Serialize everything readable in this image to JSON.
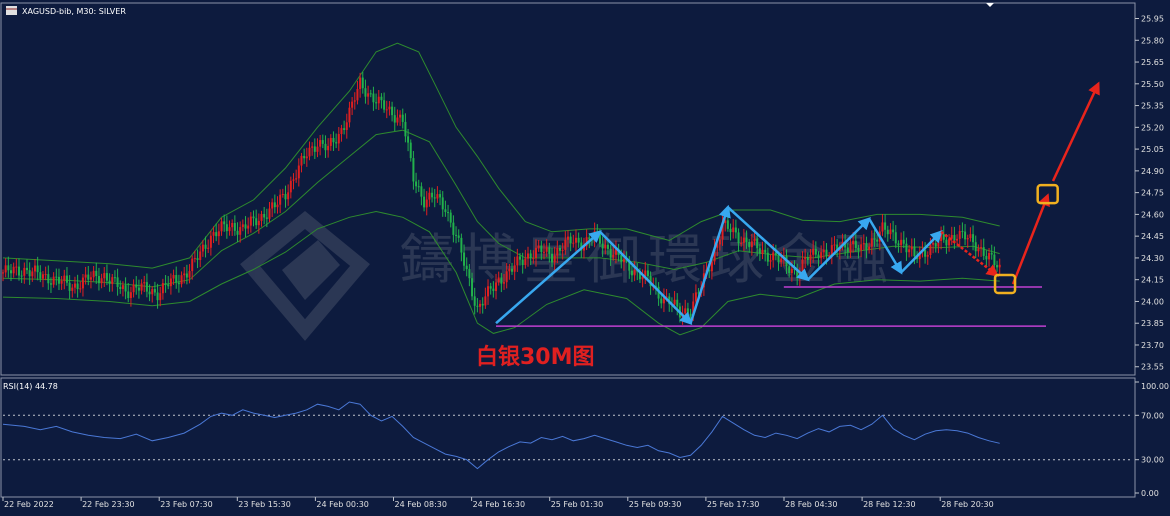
{
  "header": {
    "symbol_line": "XAGUSD-bib, M30:  SILVER",
    "rsi_line": "RSI(14) 44.78"
  },
  "annotation": {
    "title": "白银30M图"
  },
  "watermark": {
    "text": "鑄博皇御環球金融"
  },
  "colors": {
    "background": "#0d1b3e",
    "grid": "#1f2d55",
    "bull": "#e02020",
    "bear": "#22b14c",
    "bollinger": "#2e8b2e",
    "rsi_line": "#4a78d6",
    "support_line": "#c040d0",
    "blue_arrow": "#38a8f0",
    "red_arrow": "#e8241c",
    "target_box": "#f0b020",
    "title_red": "#e02020"
  },
  "chart_data": [
    {
      "type": "candlestick",
      "instrument": "XAGUSD-bib",
      "timeframe": "M30",
      "ylim": [
        23.5,
        26.05
      ],
      "yticks": [
        "25.95",
        "25.80",
        "25.65",
        "25.50",
        "25.35",
        "25.20",
        "25.05",
        "24.90",
        "24.75",
        "24.60",
        "24.45",
        "24.30",
        "24.15",
        "24.00",
        "23.85",
        "23.70",
        "23.55"
      ],
      "xticks": [
        "22 Feb 2022",
        "22 Feb 23:30",
        "23 Feb 07:30",
        "23 Feb 15:30",
        "24 Feb 00:30",
        "24 Feb 08:30",
        "24 Feb 16:30",
        "25 Feb 01:30",
        "25 Feb 09:30",
        "25 Feb 17:30",
        "28 Feb 04:30",
        "28 Feb 12:30",
        "28 Feb 20:30"
      ],
      "close_path": [
        [
          0,
          24.2
        ],
        [
          8,
          24.22
        ],
        [
          14,
          24.18
        ],
        [
          20,
          24.15
        ],
        [
          26,
          24.1
        ],
        [
          32,
          24.16
        ],
        [
          38,
          24.18
        ],
        [
          42,
          24.12
        ],
        [
          46,
          24.07
        ],
        [
          50,
          24.1
        ],
        [
          54,
          24.08
        ],
        [
          58,
          24.06
        ],
        [
          62,
          24.12
        ],
        [
          66,
          24.16
        ],
        [
          70,
          24.22
        ],
        [
          74,
          24.33
        ],
        [
          78,
          24.45
        ],
        [
          82,
          24.5
        ],
        [
          86,
          24.52
        ],
        [
          90,
          24.5
        ],
        [
          94,
          24.55
        ],
        [
          98,
          24.6
        ],
        [
          102,
          24.65
        ],
        [
          106,
          24.75
        ],
        [
          110,
          24.88
        ],
        [
          114,
          25.02
        ],
        [
          118,
          25.1
        ],
        [
          122,
          25.05
        ],
        [
          126,
          25.15
        ],
        [
          130,
          25.3
        ],
        [
          134,
          25.5
        ],
        [
          138,
          25.42
        ],
        [
          142,
          25.35
        ],
        [
          146,
          25.3
        ],
        [
          150,
          25.25
        ],
        [
          154,
          24.85
        ],
        [
          158,
          24.7
        ],
        [
          162,
          24.72
        ],
        [
          166,
          24.65
        ],
        [
          170,
          24.45
        ],
        [
          174,
          24.2
        ],
        [
          178,
          23.95
        ],
        [
          182,
          24.05
        ],
        [
          186,
          24.15
        ],
        [
          190,
          24.2
        ],
        [
          194,
          24.28
        ],
        [
          198,
          24.33
        ],
        [
          202,
          24.35
        ],
        [
          206,
          24.32
        ],
        [
          210,
          24.38
        ],
        [
          214,
          24.42
        ],
        [
          218,
          24.4
        ],
        [
          222,
          24.45
        ],
        [
          226,
          24.38
        ],
        [
          230,
          24.32
        ],
        [
          234,
          24.25
        ],
        [
          238,
          24.2
        ],
        [
          242,
          24.15
        ],
        [
          246,
          24.05
        ],
        [
          250,
          24.0
        ],
        [
          254,
          23.92
        ],
        [
          258,
          23.95
        ],
        [
          262,
          24.1
        ],
        [
          266,
          24.3
        ],
        [
          270,
          24.52
        ],
        [
          274,
          24.48
        ],
        [
          278,
          24.42
        ],
        [
          282,
          24.38
        ],
        [
          286,
          24.33
        ],
        [
          290,
          24.3
        ],
        [
          294,
          24.25
        ],
        [
          298,
          24.2
        ],
        [
          302,
          24.3
        ],
        [
          306,
          24.35
        ],
        [
          310,
          24.33
        ],
        [
          314,
          24.38
        ],
        [
          318,
          24.4
        ],
        [
          322,
          24.35
        ],
        [
          326,
          24.42
        ],
        [
          330,
          24.5
        ],
        [
          334,
          24.45
        ],
        [
          338,
          24.4
        ],
        [
          342,
          24.3
        ],
        [
          346,
          24.35
        ],
        [
          350,
          24.4
        ],
        [
          354,
          24.42
        ],
        [
          358,
          24.47
        ],
        [
          362,
          24.43
        ],
        [
          366,
          24.38
        ],
        [
          370,
          24.3
        ],
        [
          374,
          24.22
        ]
      ],
      "bollinger": {
        "upper": [
          [
            0,
            24.3
          ],
          [
            20,
            24.28
          ],
          [
            40,
            24.26
          ],
          [
            56,
            24.23
          ],
          [
            70,
            24.3
          ],
          [
            82,
            24.58
          ],
          [
            94,
            24.7
          ],
          [
            106,
            24.92
          ],
          [
            118,
            25.2
          ],
          [
            130,
            25.45
          ],
          [
            140,
            25.72
          ],
          [
            148,
            25.78
          ],
          [
            156,
            25.72
          ],
          [
            162,
            25.5
          ],
          [
            170,
            25.2
          ],
          [
            178,
            25.0
          ],
          [
            186,
            24.78
          ],
          [
            196,
            24.55
          ],
          [
            206,
            24.48
          ],
          [
            220,
            24.5
          ],
          [
            234,
            24.5
          ],
          [
            250,
            24.42
          ],
          [
            262,
            24.55
          ],
          [
            274,
            24.63
          ],
          [
            288,
            24.63
          ],
          [
            300,
            24.56
          ],
          [
            314,
            24.55
          ],
          [
            328,
            24.6
          ],
          [
            344,
            24.6
          ],
          [
            360,
            24.58
          ],
          [
            374,
            24.52
          ]
        ],
        "middle": [
          [
            0,
            24.16
          ],
          [
            20,
            24.15
          ],
          [
            40,
            24.13
          ],
          [
            56,
            24.1
          ],
          [
            70,
            24.15
          ],
          [
            82,
            24.35
          ],
          [
            94,
            24.47
          ],
          [
            106,
            24.62
          ],
          [
            118,
            24.82
          ],
          [
            130,
            25.0
          ],
          [
            140,
            25.15
          ],
          [
            150,
            25.18
          ],
          [
            160,
            25.1
          ],
          [
            170,
            24.8
          ],
          [
            178,
            24.55
          ],
          [
            186,
            24.4
          ],
          [
            196,
            24.3
          ],
          [
            210,
            24.3
          ],
          [
            224,
            24.3
          ],
          [
            238,
            24.27
          ],
          [
            252,
            24.22
          ],
          [
            264,
            24.27
          ],
          [
            276,
            24.35
          ],
          [
            290,
            24.32
          ],
          [
            304,
            24.3
          ],
          [
            318,
            24.34
          ],
          [
            334,
            24.38
          ],
          [
            350,
            24.37
          ],
          [
            364,
            24.38
          ],
          [
            374,
            24.33
          ]
        ],
        "lower": [
          [
            0,
            24.03
          ],
          [
            20,
            24.02
          ],
          [
            40,
            24.0
          ],
          [
            56,
            23.97
          ],
          [
            70,
            24.0
          ],
          [
            82,
            24.12
          ],
          [
            94,
            24.22
          ],
          [
            106,
            24.34
          ],
          [
            118,
            24.5
          ],
          [
            130,
            24.58
          ],
          [
            140,
            24.62
          ],
          [
            150,
            24.58
          ],
          [
            160,
            24.48
          ],
          [
            170,
            24.2
          ],
          [
            178,
            23.85
          ],
          [
            184,
            23.78
          ],
          [
            192,
            23.82
          ],
          [
            204,
            23.98
          ],
          [
            218,
            24.08
          ],
          [
            234,
            24.02
          ],
          [
            246,
            23.85
          ],
          [
            254,
            23.77
          ],
          [
            262,
            23.82
          ],
          [
            272,
            24.0
          ],
          [
            284,
            24.05
          ],
          [
            298,
            24.02
          ],
          [
            312,
            24.12
          ],
          [
            328,
            24.15
          ],
          [
            344,
            24.14
          ],
          [
            360,
            24.16
          ],
          [
            374,
            24.14
          ]
        ]
      },
      "support_levels": [
        23.83,
        24.1
      ],
      "marks": {
        "blue_zigzag_1": [
          [
            185,
            23.85
          ],
          [
            224,
            24.48
          ],
          [
            258,
            23.85
          ]
        ],
        "blue_zigzag_2": [
          [
            258,
            23.85
          ],
          [
            272,
            24.65
          ],
          [
            302,
            24.15
          ],
          [
            325,
            24.57
          ],
          [
            337,
            24.2
          ],
          [
            352,
            24.48
          ]
        ],
        "red_drop": [
          [
            352,
            24.48
          ],
          [
            373,
            24.18
          ]
        ],
        "red_up": [
          [
            379,
            24.12
          ],
          [
            392,
            24.73
          ]
        ],
        "red_up_2": [
          [
            394,
            24.83
          ],
          [
            411,
            25.5
          ]
        ],
        "target_boxes": [
          [
            376,
            24.12
          ],
          [
            392,
            24.74
          ]
        ]
      }
    },
    {
      "type": "line",
      "title": "RSI(14) 44.78",
      "ylim": [
        0,
        100
      ],
      "yticks": [
        "100.00",
        "70.00",
        "30.00",
        "0.00"
      ],
      "levels": [
        70,
        30
      ],
      "last": 44.78,
      "values": [
        [
          0,
          62
        ],
        [
          8,
          60
        ],
        [
          14,
          57
        ],
        [
          20,
          60
        ],
        [
          26,
          55
        ],
        [
          32,
          52
        ],
        [
          38,
          50
        ],
        [
          44,
          49
        ],
        [
          50,
          53
        ],
        [
          56,
          47
        ],
        [
          62,
          50
        ],
        [
          68,
          54
        ],
        [
          74,
          62
        ],
        [
          78,
          69
        ],
        [
          82,
          72
        ],
        [
          86,
          70
        ],
        [
          90,
          75
        ],
        [
          94,
          72
        ],
        [
          98,
          70
        ],
        [
          102,
          68
        ],
        [
          106,
          70
        ],
        [
          110,
          72
        ],
        [
          114,
          75
        ],
        [
          118,
          80
        ],
        [
          122,
          78
        ],
        [
          126,
          75
        ],
        [
          130,
          82
        ],
        [
          134,
          80
        ],
        [
          138,
          70
        ],
        [
          142,
          65
        ],
        [
          146,
          69
        ],
        [
          150,
          60
        ],
        [
          154,
          50
        ],
        [
          158,
          45
        ],
        [
          162,
          40
        ],
        [
          166,
          35
        ],
        [
          170,
          33
        ],
        [
          174,
          30
        ],
        [
          178,
          22
        ],
        [
          182,
          30
        ],
        [
          186,
          37
        ],
        [
          190,
          42
        ],
        [
          194,
          46
        ],
        [
          198,
          45
        ],
        [
          202,
          50
        ],
        [
          206,
          48
        ],
        [
          210,
          51
        ],
        [
          214,
          47
        ],
        [
          218,
          49
        ],
        [
          222,
          52
        ],
        [
          226,
          49
        ],
        [
          230,
          46
        ],
        [
          234,
          43
        ],
        [
          238,
          41
        ],
        [
          242,
          43
        ],
        [
          246,
          38
        ],
        [
          250,
          36
        ],
        [
          254,
          32
        ],
        [
          258,
          34
        ],
        [
          262,
          43
        ],
        [
          266,
          55
        ],
        [
          270,
          69
        ],
        [
          274,
          63
        ],
        [
          278,
          57
        ],
        [
          282,
          52
        ],
        [
          286,
          50
        ],
        [
          290,
          54
        ],
        [
          294,
          52
        ],
        [
          298,
          49
        ],
        [
          302,
          54
        ],
        [
          306,
          58
        ],
        [
          310,
          55
        ],
        [
          314,
          60
        ],
        [
          318,
          61
        ],
        [
          322,
          57
        ],
        [
          326,
          62
        ],
        [
          330,
          70
        ],
        [
          334,
          58
        ],
        [
          338,
          52
        ],
        [
          342,
          48
        ],
        [
          346,
          53
        ],
        [
          350,
          56
        ],
        [
          354,
          57
        ],
        [
          358,
          56
        ],
        [
          362,
          54
        ],
        [
          366,
          50
        ],
        [
          370,
          47
        ],
        [
          374,
          44.78
        ]
      ]
    }
  ]
}
